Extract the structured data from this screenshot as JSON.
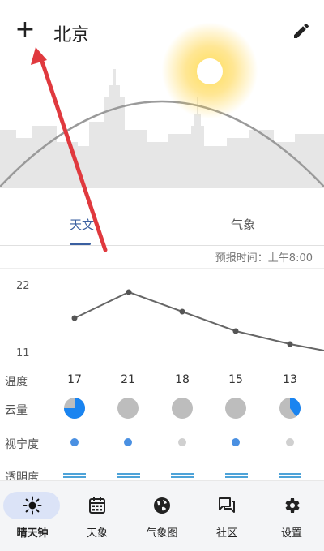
{
  "header": {
    "add_symbol": "+",
    "city": "北京"
  },
  "tabs": [
    {
      "label": "天文",
      "active": true
    },
    {
      "label": "气象",
      "active": false
    }
  ],
  "forecast_time": "预报时间：上午8:00",
  "chart": {
    "y_max_label": "22",
    "y_min_label": "11"
  },
  "chart_data": {
    "type": "line",
    "x": [
      "1",
      "2",
      "3",
      "4",
      "5",
      "6"
    ],
    "values": [
      17,
      21,
      18,
      15,
      13,
      12
    ],
    "ylim": [
      11,
      22
    ],
    "color": "#666666"
  },
  "rows": {
    "temperature": {
      "label": "温度",
      "values": [
        "17",
        "21",
        "18",
        "15",
        "13"
      ]
    },
    "cloud": {
      "label": "云量",
      "fractions": [
        0.75,
        0,
        0,
        0,
        0.4
      ]
    },
    "seeing": {
      "label": "视宁度",
      "colors": [
        "#4a90e2",
        "#4a90e2",
        "#d0d0d0",
        "#4a90e2",
        "#d0d0d0"
      ]
    },
    "transparency": {
      "label": "透明度"
    }
  },
  "colors": {
    "accent": "#3a5fa0",
    "cloud_blue": "#1a84f0",
    "cloud_gray": "#bdbdbd",
    "arrow": "#e0393e"
  },
  "nav": [
    {
      "label": "晴天钟",
      "icon": "sun-icon",
      "active": true
    },
    {
      "label": "天象",
      "icon": "calendar-icon",
      "active": false
    },
    {
      "label": "气象图",
      "icon": "globe-icon",
      "active": false
    },
    {
      "label": "社区",
      "icon": "chat-icon",
      "active": false
    },
    {
      "label": "设置",
      "icon": "gear-icon",
      "active": false
    }
  ]
}
